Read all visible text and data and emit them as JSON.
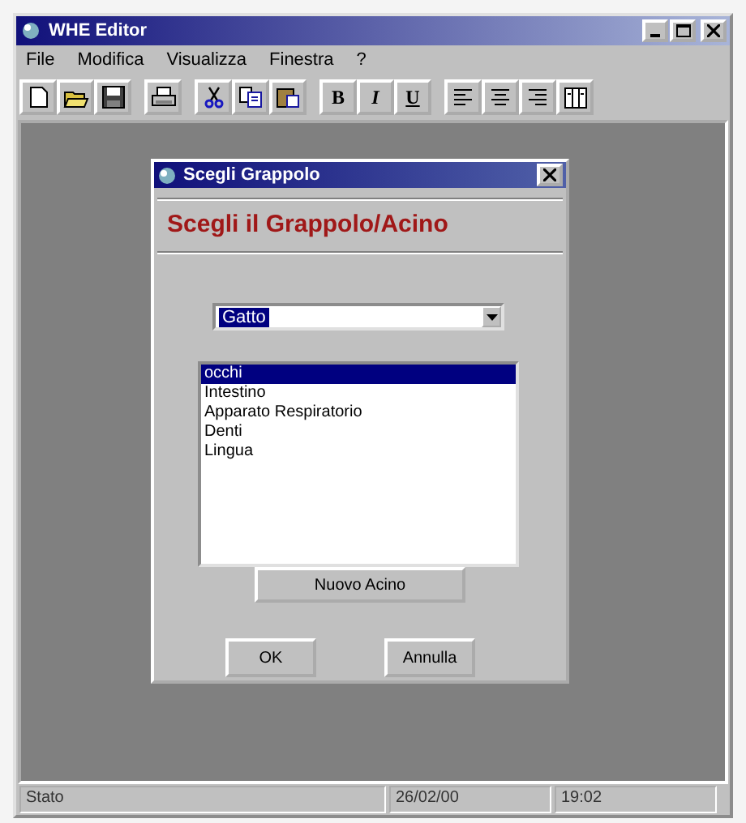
{
  "window": {
    "title": "WHE Editor"
  },
  "menu": [
    {
      "label": "File"
    },
    {
      "label": "Modifica"
    },
    {
      "label": "Visualizza"
    },
    {
      "label": "Finestra"
    },
    {
      "label": "?"
    }
  ],
  "toolbar": [
    [
      {
        "kind": "new"
      },
      {
        "kind": "open"
      },
      {
        "kind": "save"
      }
    ],
    [
      {
        "kind": "print"
      }
    ],
    [
      {
        "kind": "cut"
      },
      {
        "kind": "copy"
      },
      {
        "kind": "paste"
      }
    ],
    [
      {
        "kind": "bold",
        "label": "B"
      },
      {
        "kind": "italic",
        "label": "I"
      },
      {
        "kind": "underline",
        "label": "U"
      }
    ],
    [
      {
        "kind": "align-left"
      },
      {
        "kind": "align-center"
      },
      {
        "kind": "align-right"
      },
      {
        "kind": "columns"
      }
    ]
  ],
  "dialog": {
    "title": "Scegli Grappolo",
    "heading": "Scegli il Grappolo/Acino",
    "combo": {
      "value": "Gatto"
    },
    "list": [
      {
        "label": "occhi",
        "selected": true
      },
      {
        "label": "Intestino",
        "selected": false
      },
      {
        "label": "Apparato Respiratorio",
        "selected": false
      },
      {
        "label": "Denti",
        "selected": false
      },
      {
        "label": "Lingua",
        "selected": false
      }
    ],
    "new_button": "Nuovo Acino",
    "ok_button": "OK",
    "cancel_button": "Annulla"
  },
  "status_bar": [
    "Stato",
    "26/02/00",
    "19:02"
  ]
}
